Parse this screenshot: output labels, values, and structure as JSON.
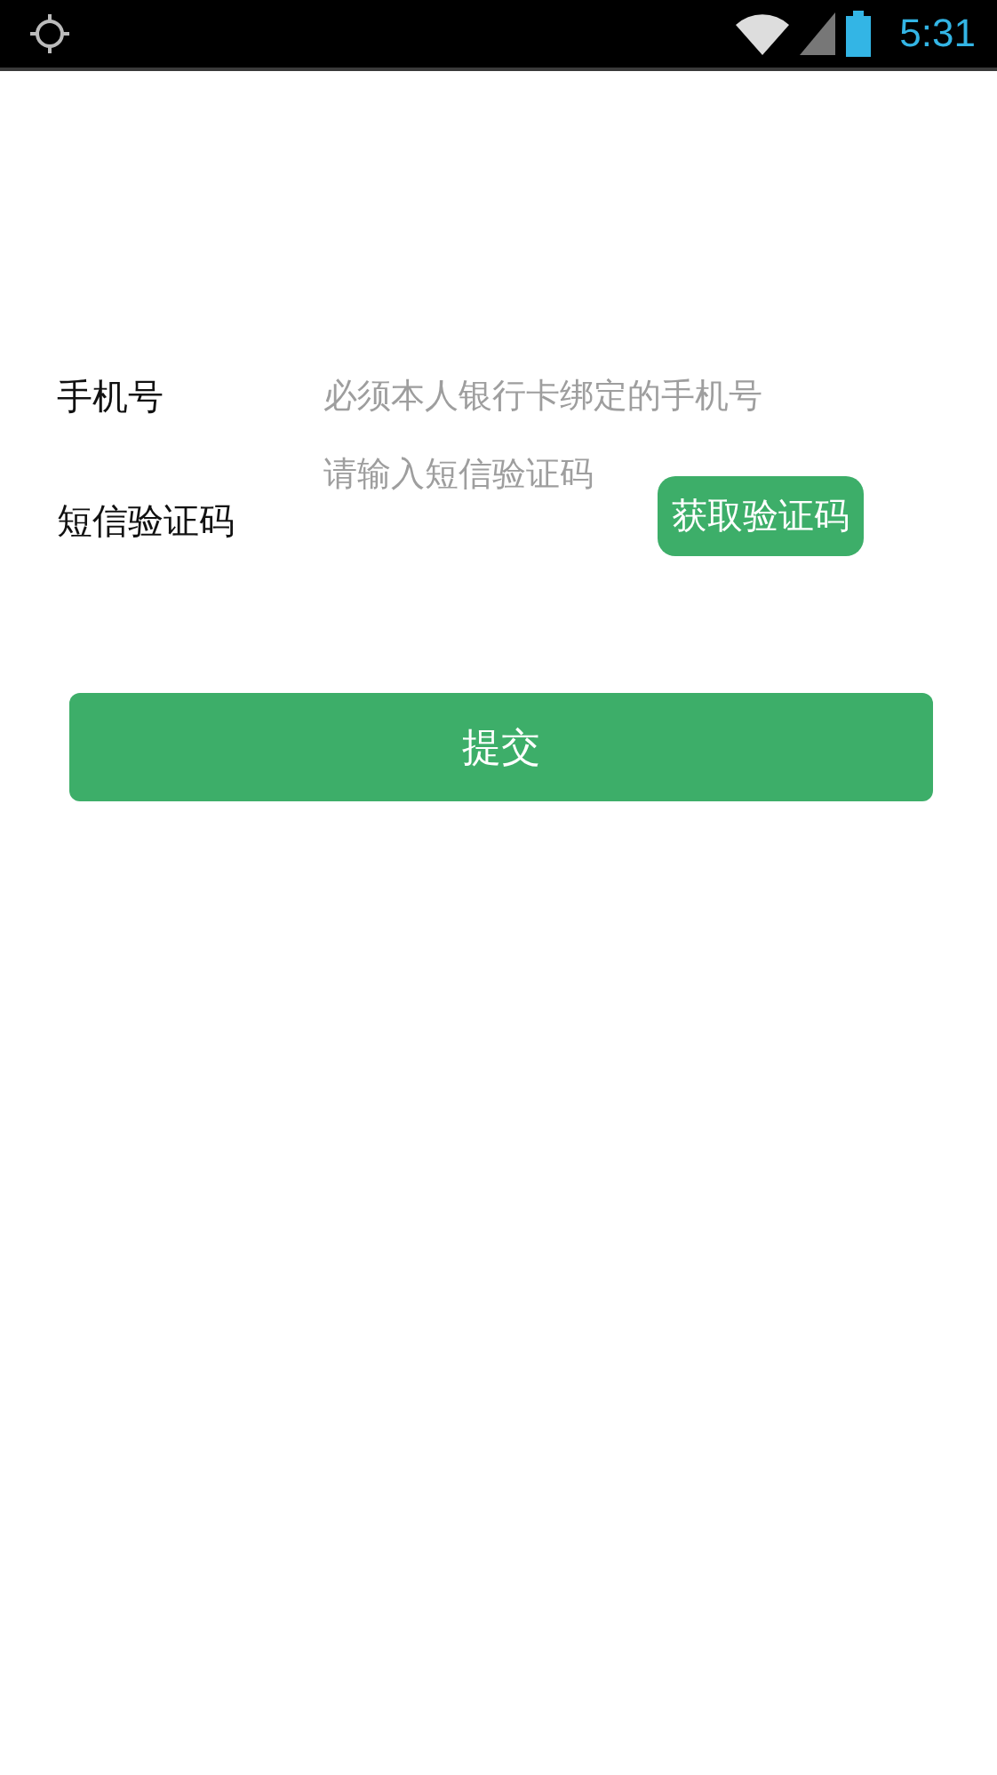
{
  "status_bar": {
    "time": "5:31"
  },
  "fields": [
    {
      "kind": "phone",
      "label": "手机号",
      "placeholder": "必须本人银行卡绑定的手机号"
    },
    {
      "kind": "code",
      "label": "短信验证码",
      "placeholder": "请输入短信验证码",
      "button": "获取验证码"
    }
  ],
  "submit_button": "提交"
}
